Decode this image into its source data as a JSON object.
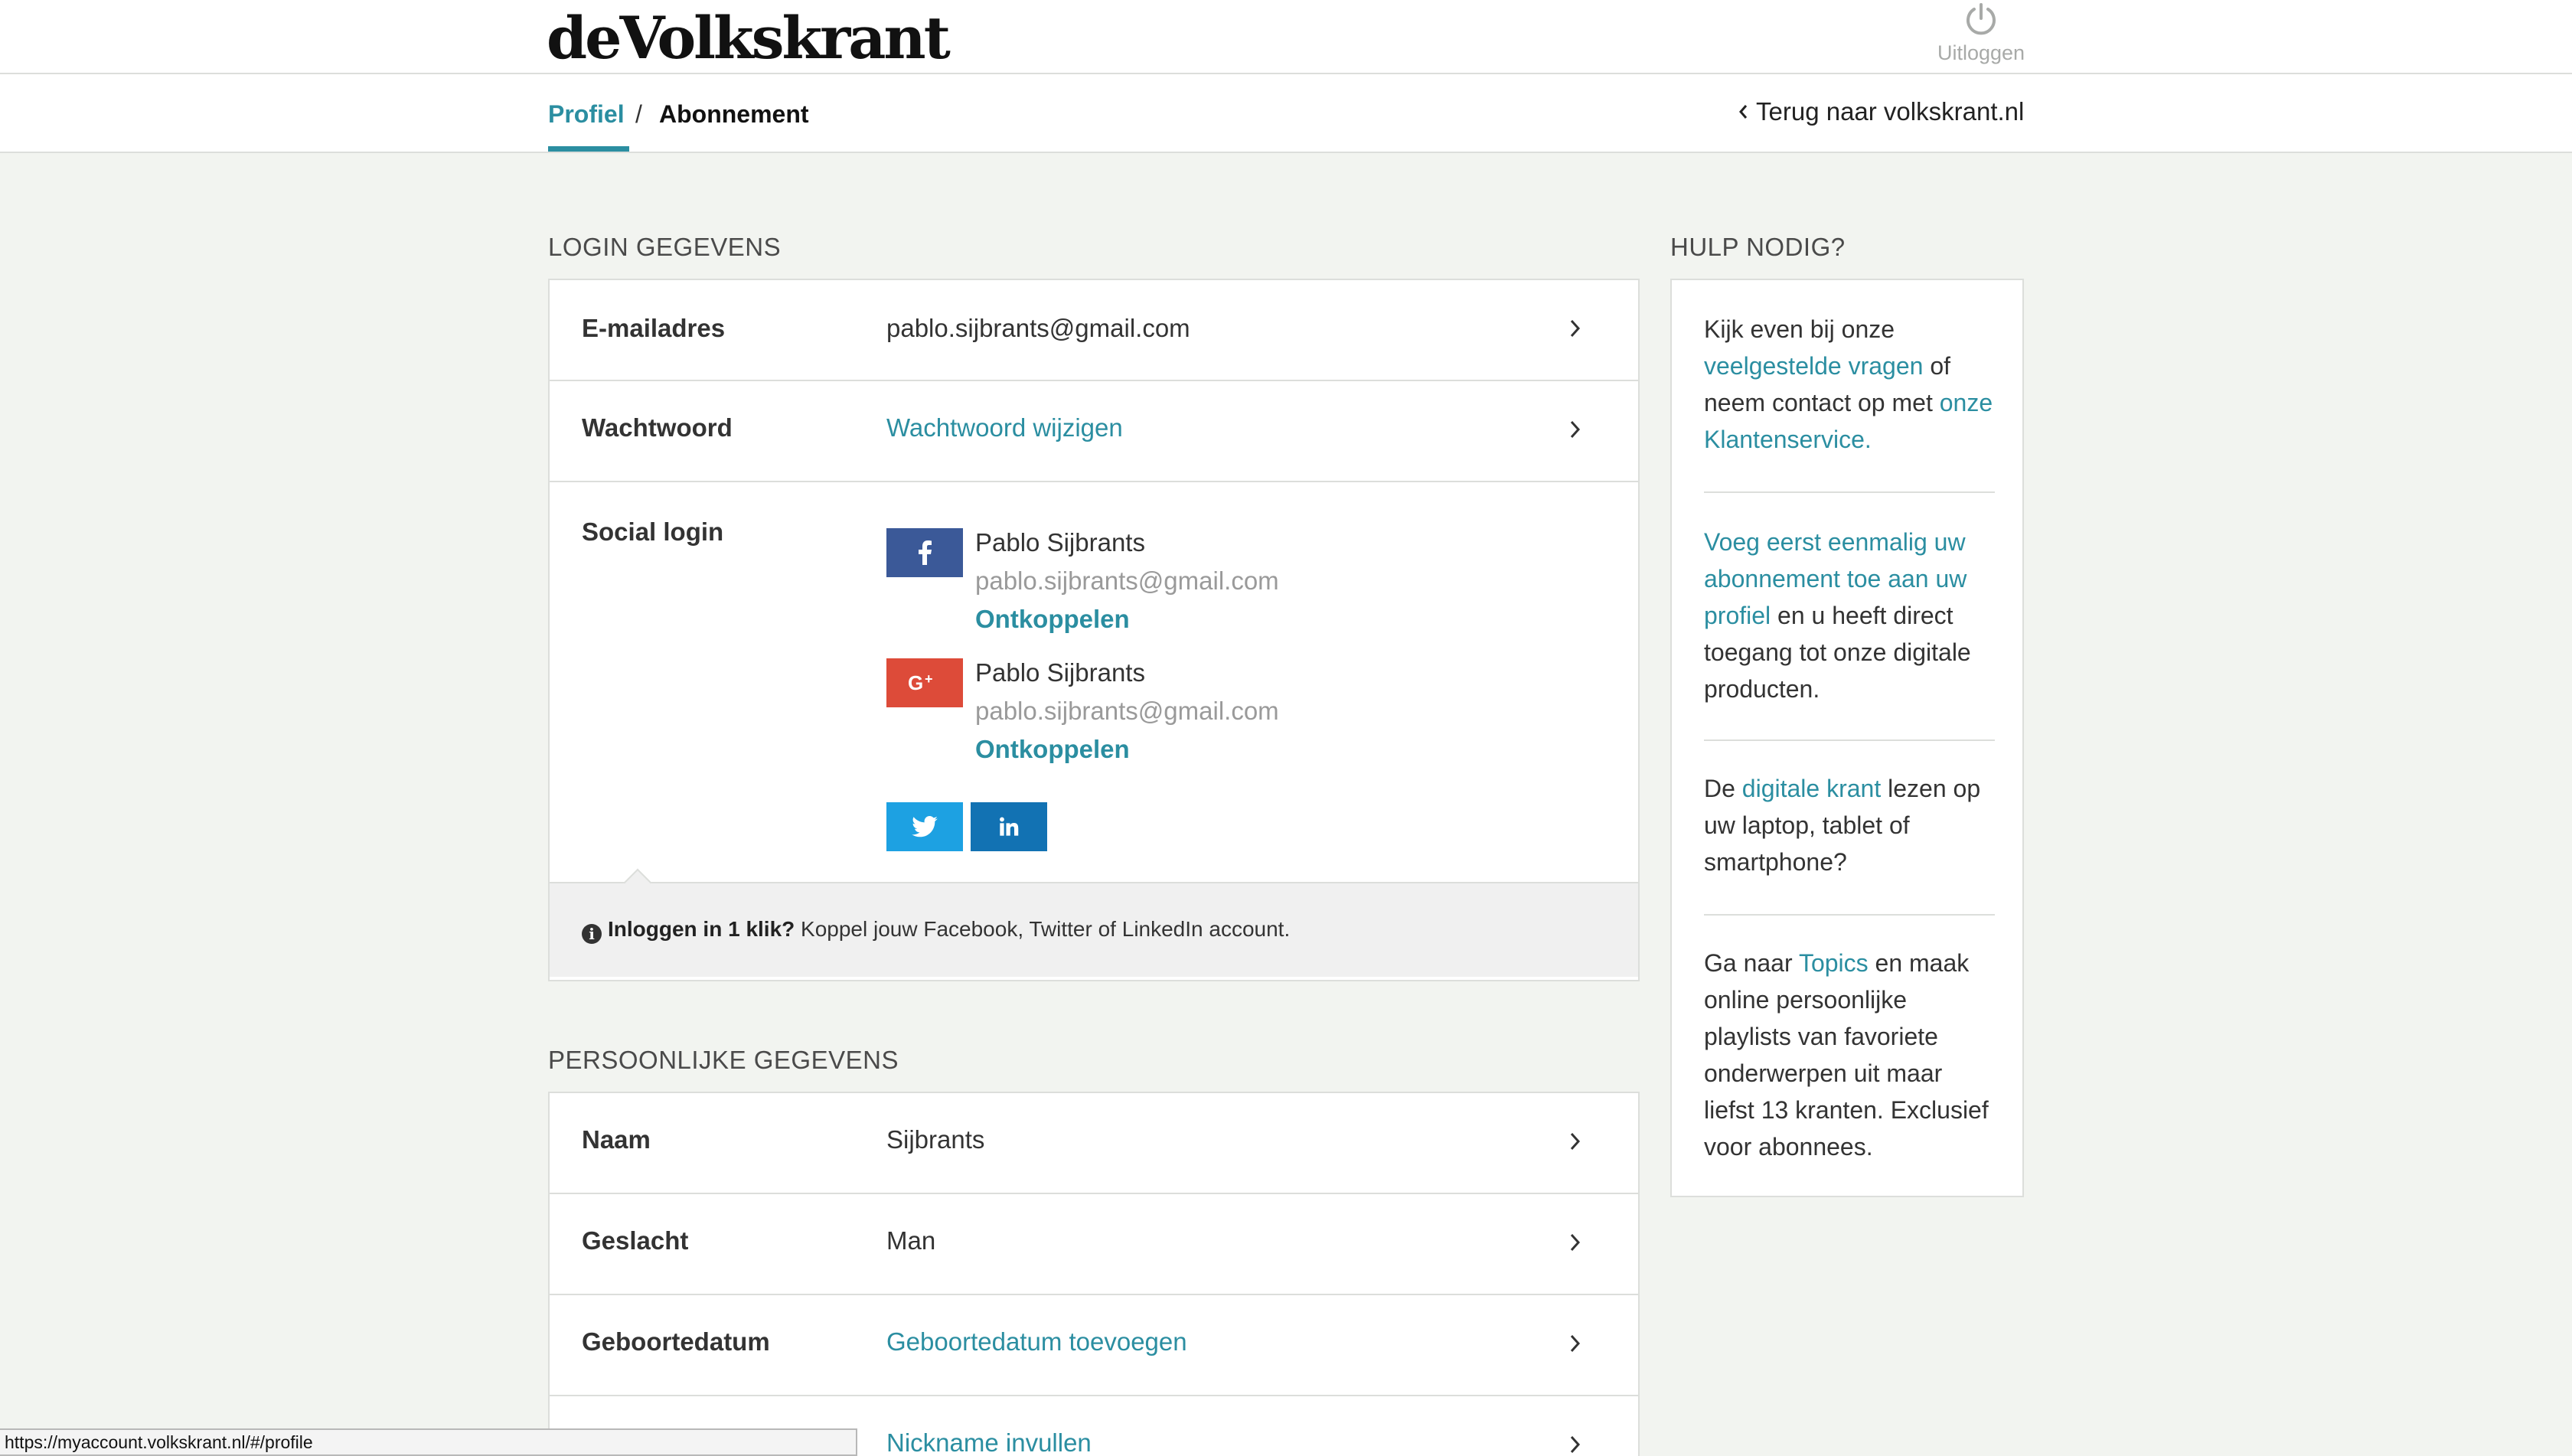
{
  "header": {
    "logo": "deVolkskrant",
    "logout_label": "Uitloggen"
  },
  "nav": {
    "tabs": [
      {
        "label": "Profiel",
        "active": true
      },
      {
        "label": "Abonnement",
        "active": false
      }
    ],
    "separator": "/",
    "back_label": "Terug naar volkskrant.nl"
  },
  "login_section": {
    "title": "LOGIN GEGEVENS",
    "rows": [
      {
        "label": "E-mailadres",
        "value": "pablo.sijbrants@gmail.com"
      },
      {
        "label": "Wachtwoord",
        "value": "Wachtwoord wijzigen"
      }
    ],
    "social": {
      "label": "Social login",
      "accounts": [
        {
          "provider": "facebook",
          "icon": "facebook-icon",
          "color": "#3b5998",
          "name": "Pablo Sijbrants",
          "email": "pablo.sijbrants@gmail.com",
          "action": "Ontkoppelen"
        },
        {
          "provider": "google-plus",
          "icon": "google-plus-icon",
          "color": "#dd4b39",
          "name": "Pablo Sijbrants",
          "email": "pablo.sijbrants@gmail.com",
          "action": "Ontkoppelen"
        }
      ],
      "connect": [
        {
          "provider": "twitter",
          "icon": "twitter-icon",
          "color": "#1da1e2"
        },
        {
          "provider": "linkedin",
          "icon": "linkedin-icon",
          "color": "#1272b3"
        }
      ],
      "info_bold": "Inloggen in 1 klik?",
      "info_text": " Koppel jouw Facebook, Twitter of LinkedIn account."
    }
  },
  "personal_section": {
    "title": "PERSOONLIJKE GEGEVENS",
    "rows": [
      {
        "label": "Naam",
        "value": "Sijbrants"
      },
      {
        "label": "Geslacht",
        "value": "Man"
      },
      {
        "label": "Geboortedatum",
        "value": "Geboortedatum toevoegen"
      },
      {
        "label": "",
        "value": "Nickname invullen"
      }
    ]
  },
  "help": {
    "title": "HULP NODIG?",
    "block1": {
      "t1": "Kijk even bij onze ",
      "link1": "veelgestelde vragen",
      "t2": " of neem contact op met ",
      "link2": "onze Klantenservice."
    },
    "block2": {
      "link1": "Voeg eerst eenmalig uw abonnement toe aan uw profiel",
      "t1": " en u heeft direct toegang tot onze digitale producten."
    },
    "block3": {
      "t1": "De ",
      "link1": "digitale krant",
      "t2": " lezen op uw laptop, tablet of smartphone?"
    },
    "block4": {
      "t1": "Ga naar ",
      "link1": "Topics",
      "t2": " en maak online persoonlijke playlists van favoriete onderwerpen uit maar liefst 13 kranten. Exclusief voor abonnees."
    }
  },
  "statusbar": {
    "url": "https://myaccount.volkskrant.nl/#/profile"
  },
  "colors": {
    "accent": "#2b8ea1",
    "background": "#f2f4f0",
    "card": "#ffffff",
    "border": "#dcdedb"
  }
}
